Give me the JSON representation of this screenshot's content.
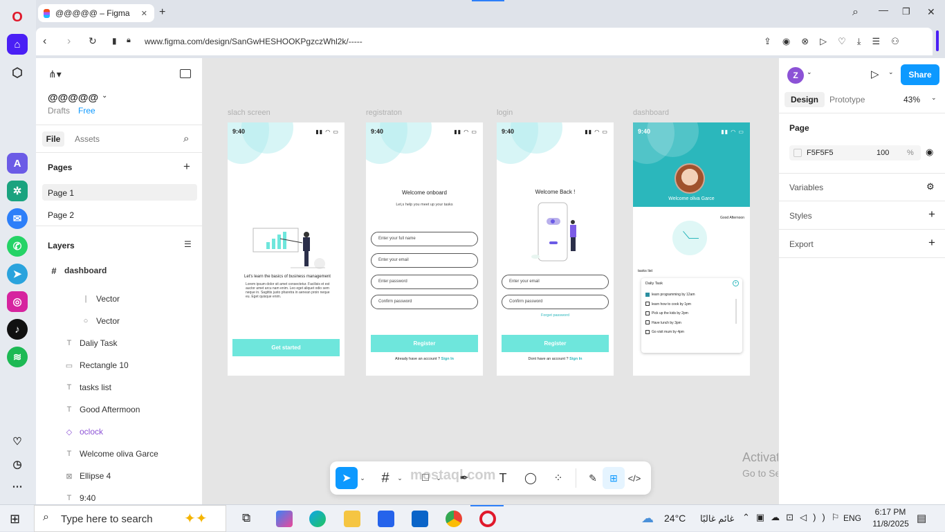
{
  "browser": {
    "tab_title": "@@@@@ – Figma",
    "url": "www.figma.com/design/SanGwHESHOOKPgzczWhl2k/-----"
  },
  "figma": {
    "file_name": "@@@@@",
    "drafts": "Drafts",
    "plan": "Free",
    "tabs": {
      "file": "File",
      "assets": "Assets"
    },
    "pages_heading": "Pages",
    "pages": [
      "Page 1",
      "Page 2"
    ],
    "layers_heading": "Layers",
    "layers": [
      {
        "name": "dashboard",
        "icon": "#"
      },
      {
        "name": "Vector",
        "icon": "|"
      },
      {
        "name": "Vector",
        "icon": "○"
      },
      {
        "name": "Daliy Task",
        "icon": "T"
      },
      {
        "name": "Rectangle 10",
        "icon": "▭"
      },
      {
        "name": "tasks list",
        "icon": "T"
      },
      {
        "name": "Good Aftermoon",
        "icon": "T"
      },
      {
        "name": "oclock",
        "icon": "◇"
      },
      {
        "name": "Welcome oliva Garce",
        "icon": "T"
      },
      {
        "name": "Ellipse 4",
        "icon": "⊠"
      },
      {
        "name": "9:40",
        "icon": "T"
      }
    ],
    "right": {
      "avatar": "Z",
      "share": "Share",
      "tab_design": "Design",
      "tab_prototype": "Prototype",
      "zoom": "43%",
      "page_label": "Page",
      "page_color": "F5F5F5",
      "page_opacity": "100",
      "pct": "%",
      "variables": "Variables",
      "styles": "Styles",
      "export": "Export"
    }
  },
  "frames": {
    "splash": {
      "label": "slach screen",
      "time": "9:40",
      "heading": "Let's learn the basics of business management",
      "body": "Lorem ipsum dolor sit amet consectetur. Facilisis et est auctor amet arcu nam enim. Leo eget aliquet odio sem neque in. Sagittis justo pharetra in aenean proin neque eu. Eget quisque enim.",
      "button": "Get started"
    },
    "register": {
      "label": "registraton",
      "time": "9:40",
      "title": "Welcome onboard",
      "subtitle": "Let,s help you meet up your tasks",
      "fields": [
        "Enter your full name",
        "Enter your email",
        "Enter password",
        "Confirm password"
      ],
      "button": "Register",
      "footer": "Already have an account ?",
      "signin": "Sign In"
    },
    "login": {
      "label": "login",
      "time": "9:40",
      "title": "Welcome Back !",
      "fields": [
        "Enter your email",
        "Confirm password"
      ],
      "forgot": "Forget password",
      "button": "Register",
      "footer": "Dont have an account ?",
      "signin": "Sign In"
    },
    "dashboard": {
      "label": "dashboard",
      "time": "9:40",
      "welcome": "Welcome oliva Garce",
      "greeting": "Good Afternoon",
      "tasks_label": "tasks list",
      "card_title": "Daliy Task",
      "tasks": [
        "learn programming by 12am",
        "learn how to cook by 1pm",
        "Pick up the kids by 2pm",
        "Have lunch by 3pm",
        "Go visit mum by 4pm"
      ]
    }
  },
  "watermark": {
    "line1": "Activate Windows",
    "line2": "Go to Settings to activate Windows."
  },
  "brand_watermark": "mostaql.com",
  "taskbar": {
    "search": "Type here to search",
    "temp": "24°C",
    "weather_text": "غائم غالبًا",
    "lang": "ENG",
    "time": "6:17 PM",
    "date": "11/8/2025"
  },
  "colors": {
    "accent": "#0d99ff",
    "teal": "#2bb7bc",
    "mint": "#6ee6dc",
    "purple": "#8c52d6"
  }
}
